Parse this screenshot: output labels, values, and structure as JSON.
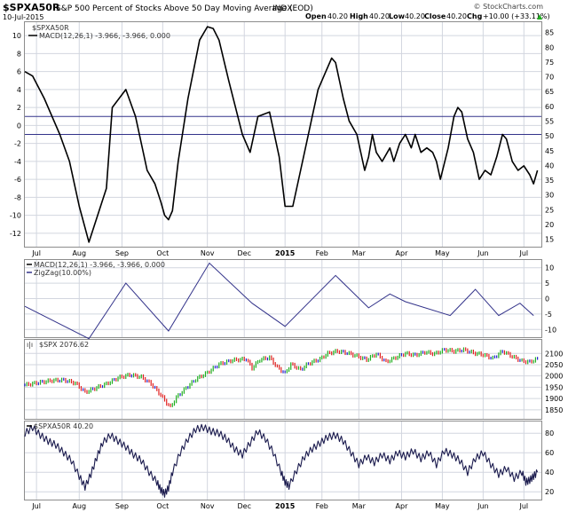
{
  "header": {
    "symbol": "$SPXA50R",
    "name": "S&P 500 Percent of Stocks Above 50 Day Moving Average (EOD)",
    "exchange": "INDX",
    "date": "10-Jul-2015",
    "open_label": "Open",
    "open_value": "40.20",
    "high_label": "High",
    "high_value": "40.20",
    "low_label": "Low",
    "low_value": "40.20",
    "close_label": "Close",
    "close_value": "40.20",
    "chg_label": "Chg",
    "chg_value": "+10.00 (+33.11%)",
    "watermark": "© StockCharts.com",
    "arrow": "▲"
  },
  "colors": {
    "line": "#000000",
    "indicator": "#33338a",
    "hline": "#33338a",
    "grid": "#d2d6df",
    "up": "#1fae1f",
    "down": "#e02020",
    "neutral": "#1f1fd0",
    "border": "#8c8c8c"
  },
  "chart_data": [
    {
      "type": "line",
      "title": "MACD(12,26,1) -3.966, -3.966, 0.000",
      "legend_main": "$SPXA50R",
      "legend_macd": "MACD(12,26,1) -3.966, -3.966, 0.000",
      "ylim_left": [
        -13.5,
        11.5
      ],
      "ylim_right": [
        12.5,
        88.5
      ],
      "left_ticks": [
        10,
        8,
        6,
        4,
        2,
        0,
        -2,
        -4,
        -6,
        -8,
        -10,
        -12
      ],
      "right_ticks": [
        85,
        80,
        75,
        70,
        65,
        60,
        55,
        50,
        45,
        40,
        35,
        30,
        25,
        20,
        15
      ],
      "hlines": [
        1,
        -1
      ],
      "x_labels": [
        {
          "x": 6,
          "label": "Jul"
        },
        {
          "x": 28,
          "label": "Aug"
        },
        {
          "x": 50,
          "label": "Sep"
        },
        {
          "x": 71,
          "label": "Oct"
        },
        {
          "x": 94,
          "label": "Nov"
        },
        {
          "x": 113,
          "label": "Dec"
        },
        {
          "x": 134,
          "label": "2015"
        },
        {
          "x": 153,
          "label": "Feb"
        },
        {
          "x": 172,
          "label": "Mar"
        },
        {
          "x": 194,
          "label": "Apr"
        },
        {
          "x": 215,
          "label": "May"
        },
        {
          "x": 236,
          "label": "Jun"
        },
        {
          "x": 257,
          "label": "Jul"
        }
      ],
      "series": [
        {
          "x": [
            0,
            4,
            10,
            18,
            23,
            28,
            33,
            42,
            45,
            52,
            57,
            63,
            67,
            70,
            72,
            74,
            76,
            79,
            84,
            90,
            94,
            97,
            100,
            105,
            112,
            116,
            120,
            126,
            131,
            134,
            138,
            142,
            145,
            148,
            151,
            155,
            158,
            160,
            164,
            167,
            171,
            175,
            177,
            179,
            181,
            184,
            188,
            190,
            193,
            196,
            199,
            201,
            204,
            207,
            210,
            212,
            214,
            218,
            221,
            223,
            225,
            228,
            231,
            234,
            237,
            240,
            243,
            246,
            248,
            251,
            254,
            257,
            260,
            262,
            264
          ],
          "y": [
            6,
            5.5,
            3,
            -1,
            -4,
            -9,
            -13,
            -7,
            2,
            4,
            1,
            -5,
            -6.5,
            -8.5,
            -10,
            -10.5,
            -9.5,
            -4,
            3,
            9.5,
            11,
            10.8,
            9.5,
            5,
            -1,
            -3,
            1,
            1.5,
            -3.5,
            -9,
            -9,
            -5,
            -2,
            1,
            4,
            6,
            7.5,
            7,
            3,
            0.5,
            -1,
            -5,
            -3.5,
            -1,
            -3,
            -4,
            -2.5,
            -4,
            -2,
            -1,
            -2.5,
            -1,
            -3,
            -2.5,
            -3,
            -4,
            -6,
            -2.5,
            1,
            2,
            1.5,
            -1.5,
            -3,
            -6,
            -5,
            -5.5,
            -3.5,
            -1,
            -1.5,
            -4,
            -5,
            -4.5,
            -5.5,
            -6.5,
            -5
          ]
        }
      ]
    },
    {
      "type": "line",
      "title": "ZigZag(10.00%)",
      "legend_macd": "MACD(12,26,1) -3.966, -3.966, 0.000",
      "legend_zigzag": "ZigZag(10.00%)",
      "ylim": [
        -12.5,
        12.5
      ],
      "right_ticks": [
        10,
        5,
        0,
        -5,
        -10
      ],
      "series": [
        {
          "name": "ZigZag(10.00%)",
          "x": [
            0,
            33,
            52,
            74,
            95,
            117,
            134,
            160,
            177,
            188,
            196,
            219,
            232,
            244,
            255,
            262
          ],
          "y": [
            -2.5,
            -13,
            5,
            -10.5,
            11.5,
            -1.5,
            -9,
            7.5,
            -3,
            1.5,
            -1,
            -5.5,
            3,
            -5.5,
            -1.5,
            -5.5
          ]
        }
      ]
    },
    {
      "type": "bar",
      "title": "$SPX 2076.62",
      "legend": "$SPX 2076.62",
      "ylim": [
        1810,
        2160
      ],
      "right_ticks": [
        2100,
        2050,
        2000,
        1950,
        1900,
        1850
      ],
      "series": [
        {
          "x": [
            0,
            8,
            14,
            20,
            26,
            31,
            36,
            42,
            48,
            54,
            60,
            65,
            70,
            73,
            75,
            78,
            84,
            88,
            94,
            100,
            107,
            114,
            117,
            121,
            126,
            130,
            134,
            137,
            142,
            146,
            152,
            156,
            161,
            166,
            171,
            176,
            181,
            186,
            191,
            196,
            201,
            206,
            211,
            216,
            221,
            226,
            231,
            236,
            241,
            246,
            251,
            256,
            260,
            264
          ],
          "y": [
            1960,
            1972,
            1980,
            1982,
            1968,
            1928,
            1945,
            1965,
            1992,
            2005,
            1995,
            1965,
            1915,
            1880,
            1862,
            1905,
            1955,
            1985,
            2015,
            2052,
            2070,
            2075,
            2035,
            2072,
            2082,
            2038,
            2012,
            2052,
            2028,
            2055,
            2075,
            2100,
            2110,
            2102,
            2088,
            2072,
            2098,
            2062,
            2082,
            2100,
            2092,
            2106,
            2098,
            2116,
            2110,
            2116,
            2102,
            2094,
            2078,
            2110,
            2086,
            2066,
            2062,
            2076
          ]
        }
      ]
    },
    {
      "type": "line",
      "title": "$SPXA50R 40.20",
      "legend": "$SPXA50R 40.20",
      "ylim": [
        12,
        92
      ],
      "right_ticks": [
        80,
        60,
        40,
        20
      ],
      "x_labels": [
        {
          "x": 6,
          "label": "Jul"
        },
        {
          "x": 28,
          "label": "Aug"
        },
        {
          "x": 50,
          "label": "Sep"
        },
        {
          "x": 71,
          "label": "Oct"
        },
        {
          "x": 94,
          "label": "Nov"
        },
        {
          "x": 113,
          "label": "Dec"
        },
        {
          "x": 134,
          "label": "2015"
        },
        {
          "x": 153,
          "label": "Feb"
        },
        {
          "x": 172,
          "label": "Mar"
        },
        {
          "x": 194,
          "label": "Apr"
        },
        {
          "x": 215,
          "label": "May"
        },
        {
          "x": 236,
          "label": "Jun"
        },
        {
          "x": 257,
          "label": "Jul"
        }
      ],
      "series": [
        {
          "x": [
            0,
            4,
            8,
            12,
            16,
            20,
            24,
            28,
            31,
            34,
            37,
            40,
            44,
            48,
            52,
            56,
            60,
            64,
            68,
            70,
            72,
            74,
            76,
            80,
            84,
            88,
            92,
            96,
            100,
            104,
            108,
            112,
            116,
            120,
            124,
            128,
            132,
            134,
            136,
            140,
            144,
            148,
            152,
            156,
            160,
            164,
            168,
            172,
            176,
            180,
            184,
            188,
            192,
            196,
            200,
            204,
            208,
            212,
            216,
            220,
            224,
            228,
            232,
            236,
            240,
            244,
            248,
            252,
            256,
            258,
            260,
            262,
            264
          ],
          "y": [
            80,
            86,
            78,
            72,
            68,
            60,
            52,
            36,
            25,
            38,
            55,
            70,
            78,
            72,
            66,
            58,
            52,
            40,
            30,
            22,
            18,
            24,
            40,
            60,
            74,
            84,
            86,
            82,
            80,
            74,
            64,
            58,
            70,
            82,
            74,
            60,
            40,
            30,
            26,
            42,
            56,
            64,
            70,
            76,
            78,
            72,
            60,
            48,
            56,
            50,
            58,
            52,
            60,
            56,
            62,
            54,
            60,
            48,
            62,
            58,
            52,
            40,
            54,
            60,
            48,
            38,
            44,
            34,
            40,
            30,
            32,
            36,
            40
          ]
        }
      ]
    }
  ]
}
